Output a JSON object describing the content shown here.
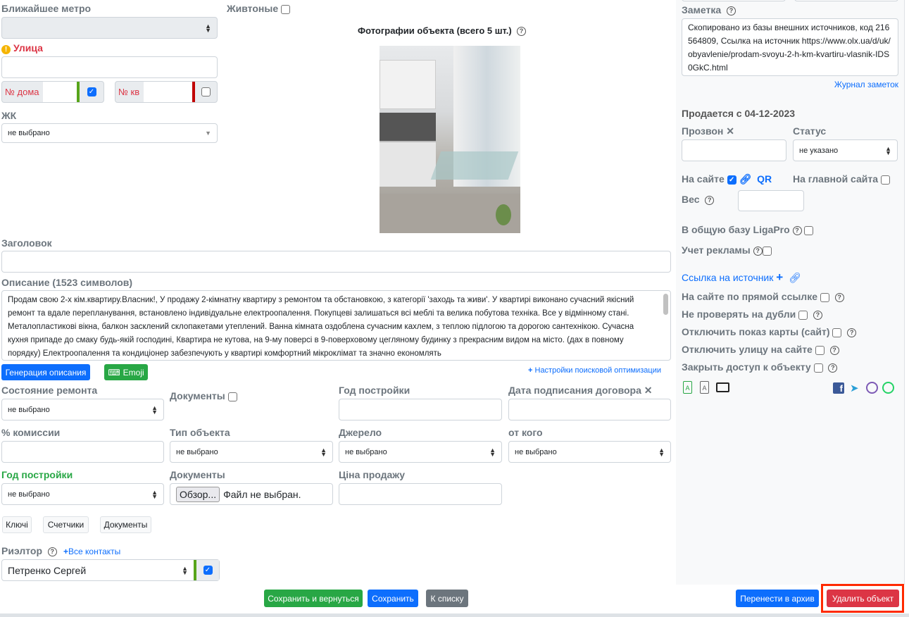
{
  "left": {
    "metro_label": "Ближайшее метро",
    "street_label": "Улица",
    "house_label": "№ дома",
    "apt_label": "№ кв",
    "complex_label": "ЖК",
    "complex_value": "не выбрано",
    "pets_label": "Живтоные",
    "photos_title": "Фотографии объекта (всего 5 шт.)",
    "title_label": "Заголовок",
    "desc_label": "Описание (1523 символов)",
    "desc_text": "Продам свою 2-х кім.квартиру.Власник!, У продажу 2-кімнатну квартиру з ремонтом та обстановкою, з категорії 'заходь та живи'. У квартирі виконано сучасний якісний ремонт та вдале перепланування, встановлено індивідуальне електроопалення. Покупцеві залишаться всі меблі та велика побутова техніка. Все у відмінному стані. Металопластикові вікна, балкон засклений склопакетами утеплений. Ванна кімната оздоблена сучасним кахлем, з теплою підлогою та дорогою сантехнікою. Сучасна кухня припаде до смаку будь-якій господині, Квартира не кутова, на 9-му поверсі в 9-поверховому цегляному будинку з прекрасним видом на місто. (дах в повному порядку) Електроопалення та кондиціонер забезпечують у квартирі комфортний мікроклімат та значно економлять",
    "gen_desc_btn": "Генерация описания",
    "emoji_btn": "Emoji",
    "seo_link": "Настройки поисковой оптимизации",
    "repair_label": "Состояние ремонта",
    "repair_value": "не выбрано",
    "docs_label": "Документы",
    "year_label": "Год постройки",
    "contract_label": "Дата подписания договора",
    "commission_label": "% комиссии",
    "type_label": "Тип объекта",
    "type_value": "не выбрано",
    "source_label": "Джерело",
    "source_value": "не выбрано",
    "from_label": "от кого",
    "from_value": "не выбрано",
    "year2_label": "Год постройки",
    "year2_value": "не выбрано",
    "docs2_label": "Документы",
    "browse_btn": "Обзор...",
    "no_file": "Файл не выбран.",
    "price_label": "Ціна продажу",
    "keys_btn": "Ключі",
    "meters_btn": "Счетчики",
    "docs_btn": "Документы",
    "realtor_label": "Риэлтор",
    "all_contacts": "Все контакты",
    "realtor_value": "Петренко Сергей"
  },
  "right": {
    "note_label": "Заметка",
    "note_text": "Скопировано из базы внешних источников, код 216564809, Ссылка на источник https://www.olx.ua/d/uk/obyavlenie/prodam-svoyu-2-h-km-kvartiru-vlasnik-IDS0GkC.html",
    "note_log": "Журнал заметок",
    "selling_since": "Продается с 04-12-2023",
    "call_label": "Прозвон",
    "status_label": "Статус",
    "status_value": "не указано",
    "on_site": "На сайте",
    "qr": "QR",
    "on_main": "На главной сайта",
    "weight": "Вес",
    "ligapro": "В общую базу LigaPro",
    "ads": "Учет рекламы",
    "source_link": "Ссылка на источник",
    "direct_link": "На сайте по прямой ссылке",
    "no_dupes": "Не проверять на дубли",
    "hide_map": "Отключить показ карты (сайт)",
    "hide_street": "Отключить улицу на сайте",
    "close_access": "Закрыть доступ к объекту"
  },
  "footer": {
    "save_return": "Сохранить и вернуться",
    "save": "Сохранить",
    "to_list": "К списку",
    "archive": "Перенести в архив",
    "delete": "Удалить объект"
  },
  "colors": {
    "primary": "#0d6efd",
    "success": "#28a745",
    "danger": "#dc3545",
    "secondary": "#6c757d",
    "highlight": "#ff2a00"
  }
}
